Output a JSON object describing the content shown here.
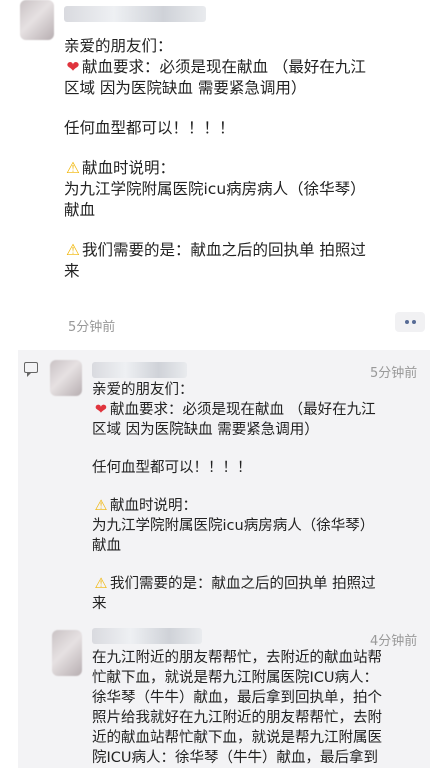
{
  "post": {
    "greeting": "亲爱的朋友们：",
    "req_line1": "献血要求：必须是现在献血 （最好在九江",
    "req_line2": "区域 因为医院缺血 需要紧急调用）",
    "any_blood": "任何血型都可以！！！！",
    "explain_title": "献血时说明：",
    "explain_line1": "为九江学院附属医院icu病房病人（徐华琴）",
    "explain_line2": "献血",
    "need_line1": "我们需要的是：献血之后的回执单 拍照过",
    "need_line2": "来",
    "time": "5分钟前"
  },
  "comments": [
    {
      "time": "5分钟前",
      "greeting": "亲爱的朋友们：",
      "req_line1": "献血要求：必须是现在献血 （最好在九江",
      "req_line2": "区域 因为医院缺血 需要紧急调用）",
      "any_blood": "任何血型都可以！！！！",
      "explain_title": "献血时说明：",
      "explain_line1": "为九江学院附属医院icu病房病人（徐华琴）",
      "explain_line2": "献血",
      "need_line1": "我们需要的是：献血之后的回执单 拍照过",
      "need_line2": "来"
    },
    {
      "time": "4分钟前",
      "lines": [
        "在九江附近的朋友帮帮忙，去附近的献血站帮",
        "忙献下血，就说是帮九江附属医院ICU病人：",
        "徐华琴（牛牛）献血，最后拿到回执单，拍个",
        "照片给我就好在九江附近的朋友帮帮忙，去附",
        "近的献血站帮忙献下血，就说是帮九江附属医",
        "院ICU病人：徐华琴（牛牛）献血，最后拿到"
      ]
    }
  ],
  "icons": {
    "heart": "❤",
    "warning": "⚠"
  },
  "colors": {
    "link_blue": "#576b95",
    "panel_bg": "#f3f3f5",
    "time_gray": "#999999"
  }
}
